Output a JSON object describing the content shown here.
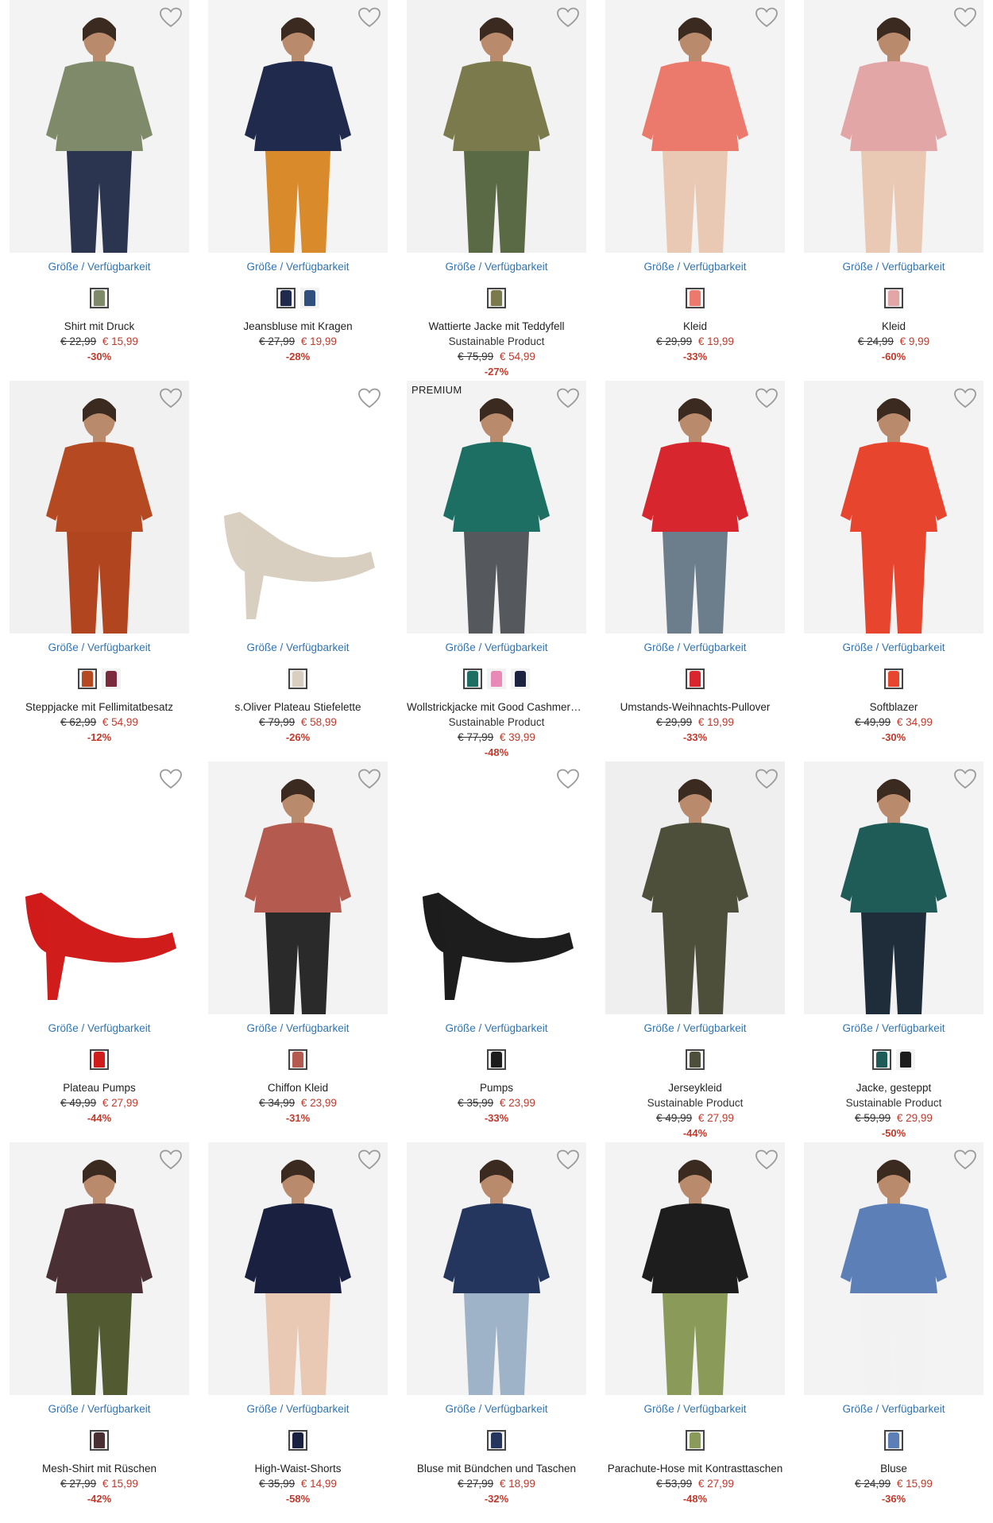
{
  "size_link_label": "Größe / Verfügbarkeit",
  "products": [
    {
      "name": "Shirt mit Druck",
      "old_price": "€ 22,99",
      "new_price": "€ 15,99",
      "discount": "-30%",
      "bg": "#f3f3f3",
      "figure": "#7f8a6a",
      "legs": "#2b3550",
      "swatches": [
        "#7f8a6a"
      ]
    },
    {
      "name": "Jeansbluse mit Kragen",
      "old_price": "€ 27,99",
      "new_price": "€ 19,99",
      "discount": "-28%",
      "bg": "#f4f4f4",
      "figure": "#1f2a4d",
      "legs": "#d98a2b",
      "swatches": [
        "#1f2a4d",
        "#2f4f7f"
      ]
    },
    {
      "name": "Wattierte Jacke mit Teddyfell",
      "subtitle": "Sustainable Product",
      "old_price": "€ 75,99",
      "new_price": "€ 54,99",
      "discount": "-27%",
      "bg": "#f2f2f2",
      "figure": "#7a7a4c",
      "legs": "#596a44",
      "swatches": [
        "#7a7a4c"
      ]
    },
    {
      "name": "Kleid",
      "old_price": "€ 29,99",
      "new_price": "€ 19,99",
      "discount": "-33%",
      "bg": "#f3f3f3",
      "figure": "#ec7a6c",
      "legs": "#e9c9b3",
      "swatches": [
        "#ec7a6c"
      ]
    },
    {
      "name": "Kleid",
      "old_price": "€ 24,99",
      "new_price": "€ 9,99",
      "discount": "-60%",
      "bg": "#f3f3f3",
      "figure": "#e3a6a6",
      "legs": "#e9c9b3",
      "swatches": [
        "#e3a6a6"
      ]
    },
    {
      "name": "Steppjacke mit Fellimitatbesatz",
      "old_price": "€ 62,99",
      "new_price": "€ 54,99",
      "discount": "-12%",
      "bg": "#f1f1f1",
      "figure": "#b54a22",
      "legs": "#b04520",
      "swatches": [
        "#b54a22",
        "#7a2a3c"
      ]
    },
    {
      "name": "s.Oliver Plateau Stiefelette",
      "old_price": "€ 79,99",
      "new_price": "€ 58,99",
      "discount": "-26%",
      "bg": "#ffffff",
      "figure": "#d9cfc0",
      "legs": "#d9cfc0",
      "swatches": [
        "#d9cfc0"
      ],
      "shoe": true
    },
    {
      "name": "Wollstrickjacke mit Good Cashmere Standard®-Anteil",
      "subtitle": "Sustainable Product",
      "badge": "PREMIUM",
      "old_price": "€ 77,99",
      "new_price": "€ 39,99",
      "discount": "-48%",
      "bg": "#f3f3f3",
      "figure": "#1d6e63",
      "legs": "#55585c",
      "swatches": [
        "#1d6e63",
        "#e889b6",
        "#1a2240"
      ]
    },
    {
      "name": "Umstands-Weihnachts-Pullover",
      "old_price": "€ 29,99",
      "new_price": "€ 19,99",
      "discount": "-33%",
      "bg": "#f3f3f3",
      "figure": "#d8262e",
      "legs": "#6c7d8c",
      "swatches": [
        "#d8262e"
      ]
    },
    {
      "name": "Softblazer",
      "old_price": "€ 49,99",
      "new_price": "€ 34,99",
      "discount": "-30%",
      "bg": "#f3f3f3",
      "figure": "#e8452f",
      "legs": "#e8452f",
      "swatches": [
        "#e8452f"
      ]
    },
    {
      "name": "Plateau Pumps",
      "old_price": "€ 49,99",
      "new_price": "€ 27,99",
      "discount": "-44%",
      "bg": "#ffffff",
      "figure": "#d11c1c",
      "legs": "#d11c1c",
      "swatches": [
        "#d11c1c"
      ],
      "shoe": true
    },
    {
      "name": "Chiffon Kleid",
      "old_price": "€ 34,99",
      "new_price": "€ 23,99",
      "discount": "-31%",
      "bg": "#f3f3f3",
      "figure": "#b55a4e",
      "legs": "#2a2a2a",
      "swatches": [
        "#b55a4e"
      ]
    },
    {
      "name": "Pumps",
      "old_price": "€ 35,99",
      "new_price": "€ 23,99",
      "discount": "-33%",
      "bg": "#ffffff",
      "figure": "#1d1d1d",
      "legs": "#1d1d1d",
      "swatches": [
        "#1d1d1d"
      ],
      "shoe": true
    },
    {
      "name": "Jerseykleid",
      "subtitle": "Sustainable Product",
      "old_price": "€ 49,99",
      "new_price": "€ 27,99",
      "discount": "-44%",
      "bg": "#efefef",
      "figure": "#4e4f3b",
      "legs": "#4e4f3b",
      "swatches": [
        "#4e4f3b"
      ]
    },
    {
      "name": "Jacke, gesteppt",
      "subtitle": "Sustainable Product",
      "old_price": "€ 59,99",
      "new_price": "€ 29,99",
      "discount": "-50%",
      "bg": "#f3f3f3",
      "figure": "#1f5c57",
      "legs": "#1f2d3a",
      "swatches": [
        "#1f5c57",
        "#1d1d1d"
      ]
    },
    {
      "name": "Mesh-Shirt mit Rüschen",
      "old_price": "€ 27,99",
      "new_price": "€ 15,99",
      "discount": "-42%",
      "bg": "#f3f3f3",
      "figure": "#4a2f34",
      "legs": "#525a32",
      "swatches": [
        "#4a2f34"
      ]
    },
    {
      "name": "High-Waist-Shorts",
      "old_price": "€ 35,99",
      "new_price": "€ 14,99",
      "discount": "-58%",
      "bg": "#f3f3f3",
      "figure": "#1a2140",
      "legs": "#e9c9b3",
      "swatches": [
        "#1a2140"
      ]
    },
    {
      "name": "Bluse mit Bündchen und Taschen",
      "old_price": "€ 27,99",
      "new_price": "€ 18,99",
      "discount": "-32%",
      "bg": "#f3f3f3",
      "figure": "#25365e",
      "legs": "#9fb3c8",
      "swatches": [
        "#25365e"
      ]
    },
    {
      "name": "Parachute-Hose mit Kontrasttaschen",
      "old_price": "€ 53,99",
      "new_price": "€ 27,99",
      "discount": "-48%",
      "bg": "#f3f3f3",
      "figure": "#1d1d1d",
      "legs": "#8a9a58",
      "swatches": [
        "#8a9a58"
      ]
    },
    {
      "name": "Bluse",
      "old_price": "€ 24,99",
      "new_price": "€ 15,99",
      "discount": "-36%",
      "bg": "#f3f3f3",
      "figure": "#5c7fb8",
      "legs": "#f2f2f2",
      "swatches": [
        "#5c7fb8"
      ]
    }
  ]
}
